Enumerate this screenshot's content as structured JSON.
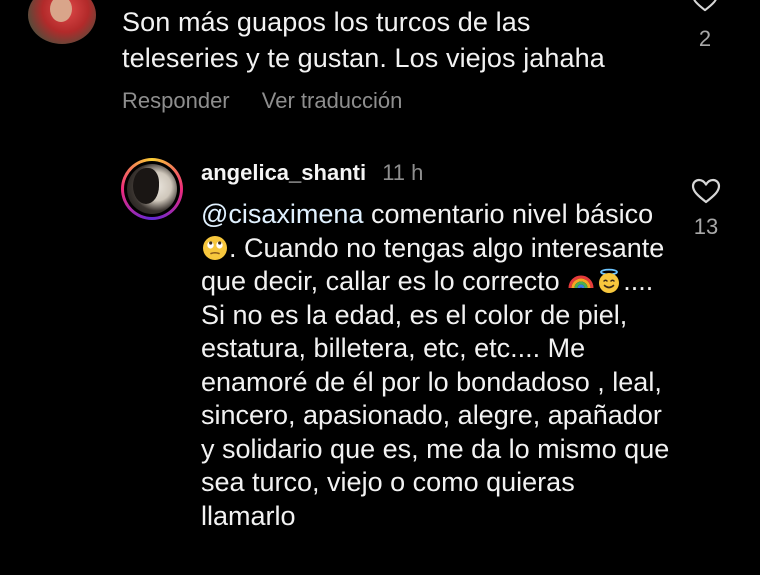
{
  "top_comment": {
    "text": "Son más guapos los turcos de las teleseries y te gustan. Los viejos jahaha",
    "like_count": "2",
    "actions": {
      "reply_label": "Responder",
      "translate_label": "Ver traducción"
    },
    "icons": {
      "avatar": "profile-photo",
      "like": "heart-outline-icon"
    }
  },
  "reply_comment": {
    "username": "angelica_shanti",
    "timestamp": "11 h",
    "mention": "@cisaximena",
    "text_part1": " comentario nivel básico ",
    "text_part2": ". Cuando no tengas algo interesante que decir, callar es lo correcto ",
    "text_part3": ".... Si no es la edad, es el color de piel, estatura, billetera, etc, etc.... Me enamoré de él por lo bondadoso , leal, sincero, apasionado, alegre, apañador y solidario que es, me da lo mismo que sea turco, viejo o como quieras llamarlo",
    "like_count": "13",
    "icons": {
      "emoji_1": "face-with-rolling-eyes",
      "emoji_2": "rainbow",
      "emoji_3": "smiling-face-with-halo",
      "like": "heart-outline-icon"
    }
  },
  "colors": {
    "background": "#000000",
    "primary_text": "#f2f2f2",
    "secondary_text": "#8e8e8e",
    "mention": "#e0f1ff"
  }
}
